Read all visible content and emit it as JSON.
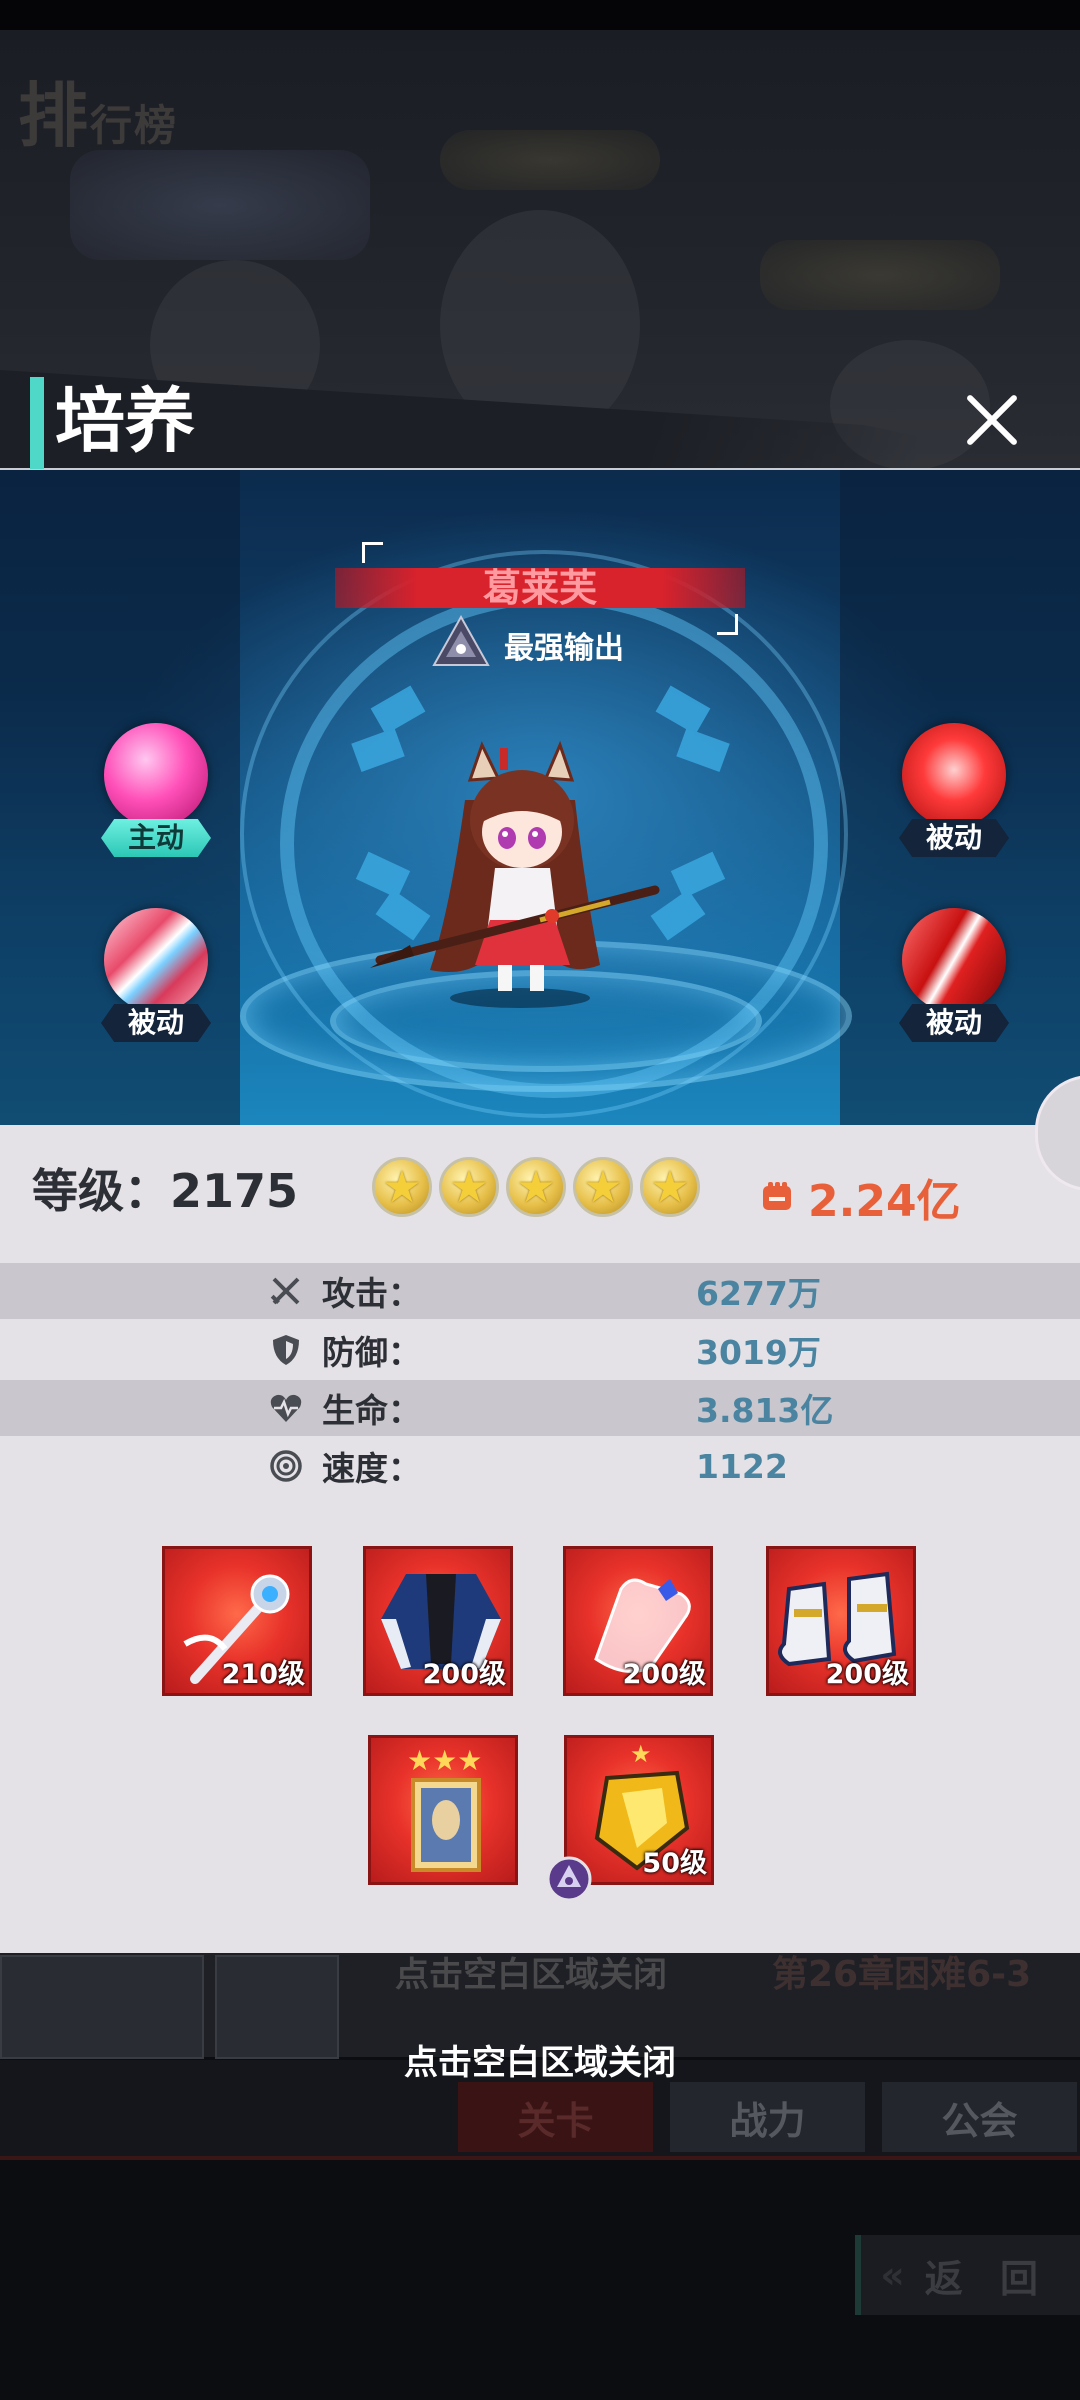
{
  "background": {
    "rank_title": "排",
    "rank_title_rest": "行榜",
    "ghost_hint": "点击空白区域关闭",
    "ghost_stage": "第26章困难6-3",
    "tabs": [
      "关卡",
      "战力",
      "公会"
    ],
    "back_label": "返 回"
  },
  "popup": {
    "title": "培养",
    "close_icon": "close-icon"
  },
  "hero": {
    "name": "葛莱芙",
    "role": "最强输出",
    "skills": [
      {
        "label": "主动",
        "icon": "skill-pink-orb-icon",
        "type": "active"
      },
      {
        "label": "被动",
        "icon": "skill-red-burst-icon",
        "type": "passive"
      },
      {
        "label": "被动",
        "icon": "skill-ice-slash-icon",
        "type": "passive"
      },
      {
        "label": "被动",
        "icon": "skill-red-slash-icon",
        "type": "passive"
      }
    ]
  },
  "stats": {
    "level_label": "等级：2175",
    "star_count": 5,
    "power": "2.24亿",
    "rows": [
      {
        "icon": "attack-swords-icon",
        "label": "攻击：",
        "value": "6277万"
      },
      {
        "icon": "defense-shield-icon",
        "label": "防御：",
        "value": "3019万"
      },
      {
        "icon": "life-heart-icon",
        "label": "生命：",
        "value": "3.813亿"
      },
      {
        "icon": "speed-swirl-icon",
        "label": "速度：",
        "value": "1122"
      }
    ]
  },
  "equipment": [
    {
      "icon": "staff-weapon-icon",
      "level": "210级"
    },
    {
      "icon": "armor-coat-icon",
      "level": "200级"
    },
    {
      "icon": "glove-icon",
      "level": "200级"
    },
    {
      "icon": "boots-icon",
      "level": "200级"
    },
    {
      "icon": "portrait-card-icon",
      "level": ""
    },
    {
      "icon": "gold-crystal-icon",
      "level": "50级"
    }
  ],
  "hint": "点击空白区域关闭",
  "colors": {
    "accent": "#4fd8c8",
    "power": "#e8603a",
    "stat_value": "#4a84a0",
    "banner_red": "#d8222c"
  }
}
